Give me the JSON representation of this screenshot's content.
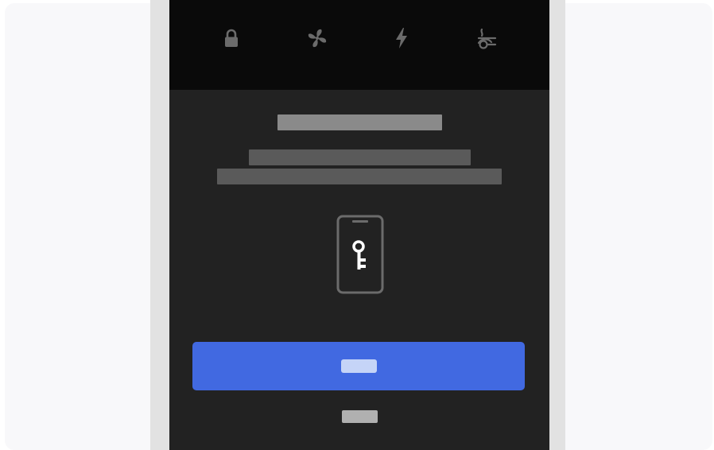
{
  "theme": {
    "page_background": "#f8f8fa",
    "device_frame": "#e2e2e2",
    "screen_background": "#222222",
    "top_bar_background": "#0a0a0a",
    "icon_color": "#6b6b6b",
    "title_placeholder": "#8a8a8a",
    "subtitle_placeholder": "#5a5a5a",
    "primary_accent": "#4169e1",
    "primary_label_placeholder": "#c5d4f7",
    "secondary_label_placeholder": "#b0b0b0",
    "illustration_color": "#6b6b6b",
    "key_color": "#ffffff"
  },
  "top_bar": {
    "icons": [
      {
        "name": "lock-icon"
      },
      {
        "name": "fan-icon"
      },
      {
        "name": "lightning-icon"
      },
      {
        "name": "seat-heater-icon"
      }
    ]
  },
  "content": {
    "illustration": "phone-key-icon"
  }
}
